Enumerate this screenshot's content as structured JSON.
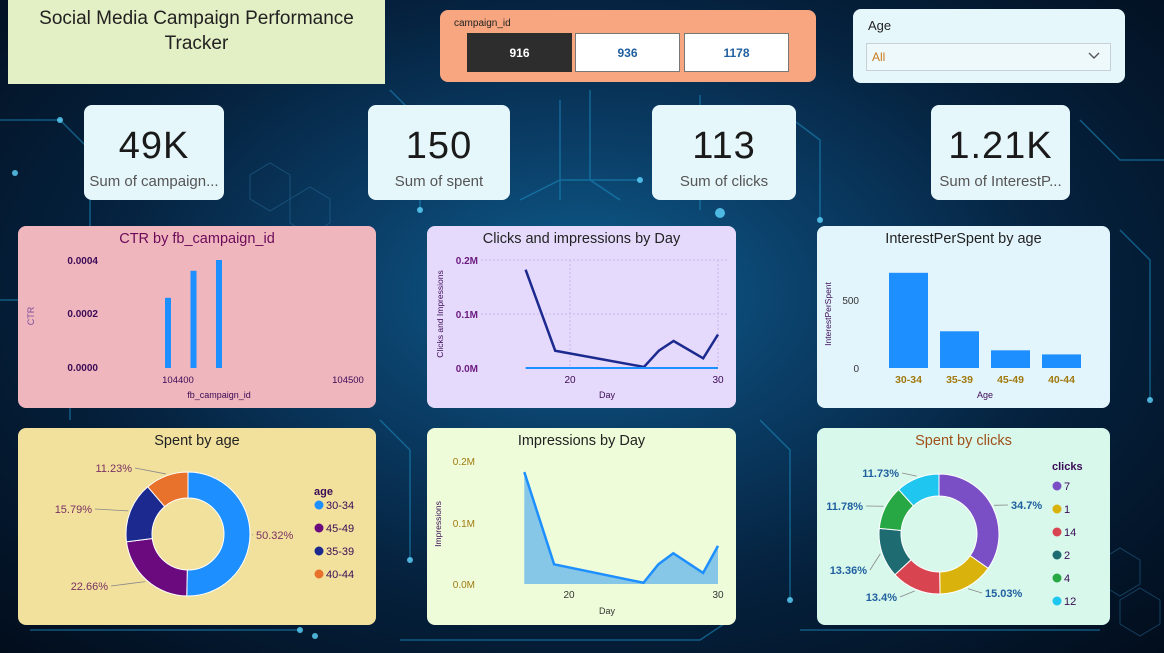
{
  "header": {
    "title_line1": "Social Media Campaign Performance",
    "title_line2": "Tracker"
  },
  "campaign_slicer": {
    "label": "campaign_id",
    "options": [
      "916",
      "936",
      "1178"
    ],
    "selected": "916"
  },
  "age_slicer": {
    "label": "Age",
    "value": "All"
  },
  "kpis": [
    {
      "value": "49K",
      "caption": "Sum of campaign..."
    },
    {
      "value": "150",
      "caption": "Sum of spent"
    },
    {
      "value": "113",
      "caption": "Sum of clicks"
    },
    {
      "value": "1.21K",
      "caption": "Sum of InterestP..."
    }
  ],
  "colors": {
    "bar_blue": "#1e8fff",
    "dark_navy": "#1c2a8f",
    "orange": "#e8712b",
    "purple": "#6b0a7f"
  },
  "chart_data": [
    {
      "type": "bar",
      "title": "CTR by fb_campaign_id",
      "xlabel": "fb_campaign_id",
      "ylabel": "CTR",
      "x_ticks": [
        "104400",
        "104500"
      ],
      "y_ticks": [
        "0.0000",
        "0.0002",
        "0.0004"
      ],
      "x": [
        104400,
        104415,
        104430
      ],
      "values": [
        0.00026,
        0.00036,
        0.0004
      ],
      "ylim": [
        0,
        0.0004
      ]
    },
    {
      "type": "line",
      "title": "Clicks and impressions by Day",
      "xlabel": "Day",
      "ylabel": "Clicks and Impressions",
      "x_ticks": [
        "20",
        "30"
      ],
      "y_ticks": [
        "0.0M",
        "0.1M",
        "0.2M"
      ],
      "series": [
        {
          "x": [
            17,
            19,
            25,
            26,
            27,
            29,
            30
          ],
          "values": [
            182000,
            32000,
            2000,
            32000,
            50000,
            18000,
            62000
          ]
        },
        {
          "x": [
            17,
            30
          ],
          "values": [
            0,
            0
          ]
        }
      ]
    },
    {
      "type": "bar",
      "title": "InterestPerSpent by age",
      "xlabel": "Age",
      "ylabel": "InterestPerSpent",
      "categories": [
        "30-34",
        "35-39",
        "45-49",
        "40-44"
      ],
      "values": [
        700,
        270,
        130,
        100
      ],
      "y_ticks": [
        "0",
        "500"
      ]
    },
    {
      "type": "pie",
      "title": "Spent by age",
      "legend_title": "age",
      "labels": [
        "30-34",
        "45-49",
        "35-39",
        "40-44"
      ],
      "values": [
        50.32,
        22.66,
        15.79,
        11.23
      ],
      "display": [
        "50.32%",
        "22.66%",
        "15.79%",
        "11.23%"
      ],
      "colors": [
        "#1e8fff",
        "#6b0a7f",
        "#1c2a8f",
        "#e8712b"
      ]
    },
    {
      "type": "area",
      "title": "Impressions by Day",
      "xlabel": "Day",
      "ylabel": "Impressions",
      "x_ticks": [
        "20",
        "30"
      ],
      "y_ticks": [
        "0.0M",
        "0.1M",
        "0.2M"
      ],
      "x": [
        17,
        19,
        25,
        26,
        27,
        29,
        30
      ],
      "values": [
        182000,
        32000,
        2000,
        32000,
        50000,
        18000,
        62000
      ]
    },
    {
      "type": "pie",
      "title": "Spent by clicks",
      "legend_title": "clicks",
      "labels": [
        "7",
        "1",
        "14",
        "2",
        "4",
        "12"
      ],
      "values": [
        34.7,
        15.03,
        13.4,
        13.36,
        11.78,
        11.73
      ],
      "display": [
        "34.7%",
        "15.03%",
        "13.4%",
        "13.36%",
        "11.78%",
        "11.73%"
      ],
      "colors": [
        "#7a4fc6",
        "#d9b20b",
        "#d94451",
        "#1f6b72",
        "#28a745",
        "#1fc7f0"
      ]
    }
  ]
}
